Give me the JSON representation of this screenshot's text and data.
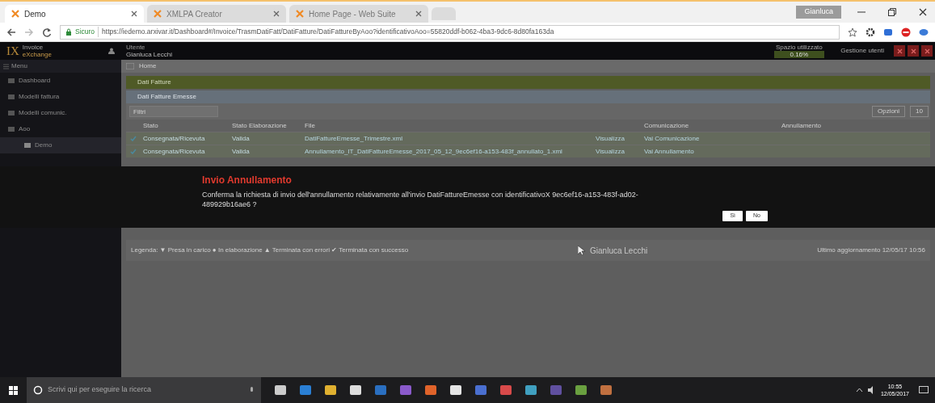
{
  "browser": {
    "tabs": [
      {
        "label": "Demo",
        "selected": true
      },
      {
        "label": "XMLPA Creator",
        "selected": false
      },
      {
        "label": "Home Page - Web Suite",
        "selected": false
      }
    ],
    "user_badge": "Gianluca",
    "security": "Sicuro",
    "url": "https://iedemo.arxivar.it/Dashboard#/Invoice/TrasmDatiFatt/DatiFatture/DatiFattureByAoo?identificativoAoo=55820ddf-b062-4ba3-9dc6-8d80fa163da"
  },
  "app": {
    "logo": {
      "mark": "IX",
      "line_1": "Invoice",
      "line_2": "eXchange"
    },
    "user": {
      "caption": "Utente",
      "name": "Gianluca Lecchi"
    },
    "quota": {
      "caption": "Spazio utilizzato",
      "reading": "0.16%"
    },
    "header_link": "Gestione utenti",
    "sidebar": {
      "menu": "Menu",
      "items": [
        {
          "label": "Dashboard",
          "selected": false
        },
        {
          "label": "Modelli fattura",
          "selected": false
        },
        {
          "label": "Modelli comunic.",
          "selected": false
        },
        {
          "label": "Aoo",
          "selected": false,
          "children": [
            {
              "label": "Demo",
              "selected": true
            }
          ]
        }
      ]
    },
    "breadcrumb": "Home",
    "section": "Dati Fatture",
    "subsection": "Dati Fatture Emesse",
    "filter": {
      "placeholder": "Filtri"
    },
    "options": "Opzioni",
    "page_size": "10",
    "table": {
      "columns": [
        "Stato",
        "Stato Elaborazione",
        "File",
        "",
        "Comunicazione",
        "Annullamento"
      ],
      "rows": [
        {
          "stato": "Consegnata/Ricevuta",
          "elaborazione": "Valida",
          "file": "DatiFattureEmesse_Trimestre.xml",
          "action": "Visualizza",
          "link": "Vai Comunicazione"
        },
        {
          "stato": "Consegnata/Ricevuta",
          "elaborazione": "Valida",
          "file": "Annullamento_IT_DatiFattureEmesse_2017_05_12_9ec6ef16-a153-483f_annullato_1.xml",
          "action": "Visualizza",
          "link": "Vai Annullamento"
        }
      ]
    },
    "legend": "Legenda: ▼ Presa in carico  ● In elaborazione  ▲ Terminata con errori  ✔ Terminata con successo",
    "presenter": "Gianluca Lecchi",
    "updated": "Ultimo aggiornamento 12/05/17 10:56"
  },
  "dialog": {
    "title": "Invio Annullamento",
    "message": "Conferma la richiesta di invio dell'annullamento relativamente all'invio DatiFattureEmesse con identificativoX 9ec6ef16-a153-483f-ad02-489929b16ae6 ?",
    "buttons": [
      "Sì",
      "No"
    ]
  },
  "taskbar": {
    "search": {
      "placeholder": "Scrivi qui per eseguire la ricerca"
    },
    "time": "10:55",
    "date": "12/05/2017"
  }
}
